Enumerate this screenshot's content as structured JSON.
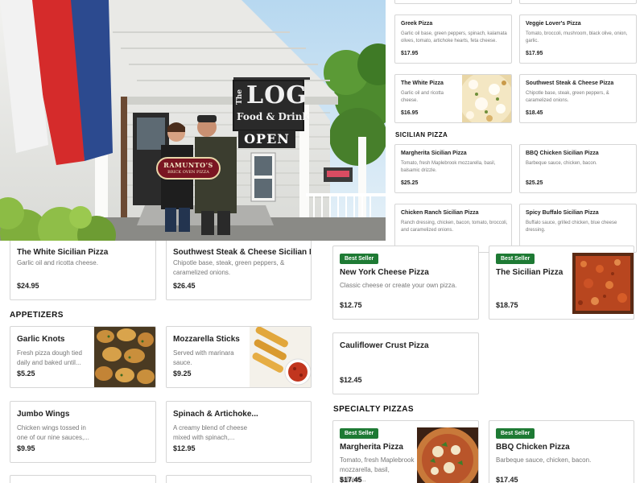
{
  "photo": {
    "storefront_sign": [
      "The",
      "LOG",
      "Food & Drink"
    ],
    "open_sign": "OPEN",
    "held_sign": [
      "RAMUNTO'S",
      "BRICK OVEN PIZZA"
    ]
  },
  "top_right_menu": {
    "specialty_items": [
      {
        "name": "Greek Pizza",
        "desc": "Garlic oil base, green peppers, spinach, kalamata olives, tomato, artichoke hearts, feta cheese.",
        "price": "$17.95"
      },
      {
        "name": "Veggie Lover's Pizza",
        "desc": "Tomato, broccoli, mushroom, black olive, onion, garlic.",
        "price": "$17.95"
      },
      {
        "name": "The White Pizza",
        "desc": "Garlic oil and ricotta cheese.",
        "price": "$16.95",
        "thumb": "white-pizza-photo"
      },
      {
        "name": "Southwest Steak & Cheese Pizza",
        "desc": "Chipotle base, steak, green peppers, & caramelized onions.",
        "price": "$18.45"
      }
    ],
    "sicilian_heading": "SICILIAN PIZZA",
    "sicilian_items": [
      {
        "name": "Margherita Sicilian Pizza",
        "desc": "Tomato, fresh Maplebrook mozzarella, basil, balsamic drizzle.",
        "price": "$25.25"
      },
      {
        "name": "BBQ Chicken Sicilian Pizza",
        "desc": "Barbeque sauce, chicken, bacon.",
        "price": "$25.25"
      },
      {
        "name": "Chicken Ranch Sicilian Pizza",
        "desc": "Ranch dressing, chicken, bacon, tomato, broccoli, and caramelized onions."
      },
      {
        "name": "Spicy Buffalo Sicilian Pizza",
        "desc": "Buffalo sauce, grilled chicken, blue cheese dressing."
      }
    ]
  },
  "left_column": {
    "sicilian_items": [
      {
        "name": "The White Sicilian Pizza",
        "desc": "Garlic oil and ricotta cheese.",
        "price": "$24.95"
      },
      {
        "name": "Southwest Steak & Cheese Sicilian Pizza",
        "desc": "Chipotle base, steak, green peppers, & caramelized onions.",
        "price": "$26.45"
      }
    ],
    "appetizers_heading": "APPETIZERS",
    "appetizers": [
      {
        "name": "Garlic Knots",
        "desc": "Fresh pizza dough tied daily and baked until...",
        "price": "$5.25",
        "thumb": "garlic-knots-photo"
      },
      {
        "name": "Mozzarella Sticks",
        "desc": "Served with marinara sauce.",
        "price": "$9.25",
        "thumb": "mozzarella-sticks-photo"
      },
      {
        "name": "Jumbo Wings",
        "desc": "Chicken wings tossed in one of our nine sauces,...",
        "price": "$9.95"
      },
      {
        "name": "Spinach & Artichoke...",
        "desc": "A creamy blend of cheese mixed with spinach,...",
        "price": "$12.95"
      }
    ]
  },
  "right_column": {
    "classic_items": [
      {
        "badge": "Best Seller",
        "name": "New York Cheese Pizza",
        "desc": "Classic cheese or create your own pizza.",
        "price": "$12.75"
      },
      {
        "badge": "Best Seller",
        "name": "The Sicilian Pizza",
        "desc": "",
        "price": "$18.75",
        "thumb": "sicilian-pizza-photo"
      },
      {
        "name": "Cauliflower Crust Pizza",
        "desc": "",
        "price": "$12.45"
      }
    ],
    "specialty_heading": "SPECIALTY PIZZAS",
    "specialty_items": [
      {
        "badge": "Best Seller",
        "name": "Margherita Pizza",
        "desc": "Tomato, fresh Maplebrook mozzarella, basil, balsam...",
        "price": "$17.45",
        "thumb": "margherita-pizza-photo"
      },
      {
        "badge": "Best Seller",
        "name": "BBQ Chicken Pizza",
        "desc": "Barbeque sauce, chicken, bacon.",
        "price": "$17.45"
      }
    ]
  },
  "colors": {
    "badge_green": "#1e7a34",
    "card_border": "#d6d6d6",
    "muted_text": "#777777"
  }
}
